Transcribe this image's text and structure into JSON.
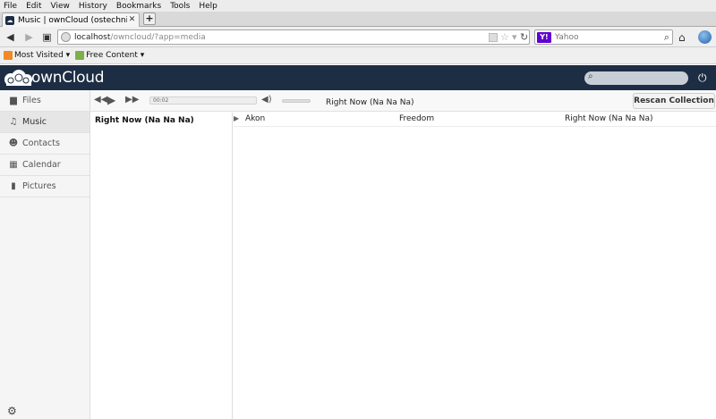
{
  "browser": {
    "menu": [
      "File",
      "Edit",
      "View",
      "History",
      "Bookmarks",
      "Tools",
      "Help"
    ],
    "tab_title": "Music | ownCloud (ostechnix)",
    "new_tab": "+",
    "url_host": "localhost",
    "url_path": "/owncloud/?app=media",
    "search_engine": "Y!",
    "search_placeholder": "Yahoo",
    "bookmarks": [
      {
        "label": "Most Visited ▾",
        "icon": "rss-icon"
      },
      {
        "label": "Free Content ▾",
        "icon": "folder-icon"
      }
    ]
  },
  "owncloud": {
    "logo_text": "ownCloud",
    "search_placeholder": ""
  },
  "sidebar": {
    "items": [
      {
        "label": "Files",
        "icon": "folder-icon"
      },
      {
        "label": "Music",
        "icon": "music-note-icon"
      },
      {
        "label": "Contacts",
        "icon": "people-icon"
      },
      {
        "label": "Calendar",
        "icon": "calendar-icon"
      },
      {
        "label": "Pictures",
        "icon": "picture-icon"
      }
    ],
    "active": "Music"
  },
  "player": {
    "time": "00:02",
    "now_playing": "Right Now (Na Na Na)",
    "rescan_label": "Rescan Collection"
  },
  "playlist": {
    "items": [
      "Right Now (Na Na Na)"
    ]
  },
  "collection": {
    "rows": [
      {
        "artist": "Akon",
        "album": "Freedom",
        "title": "Right Now (Na Na Na)"
      }
    ]
  },
  "colors": {
    "header_bg": "#1d2d44",
    "sidebar_bg": "#f5f5f5"
  }
}
